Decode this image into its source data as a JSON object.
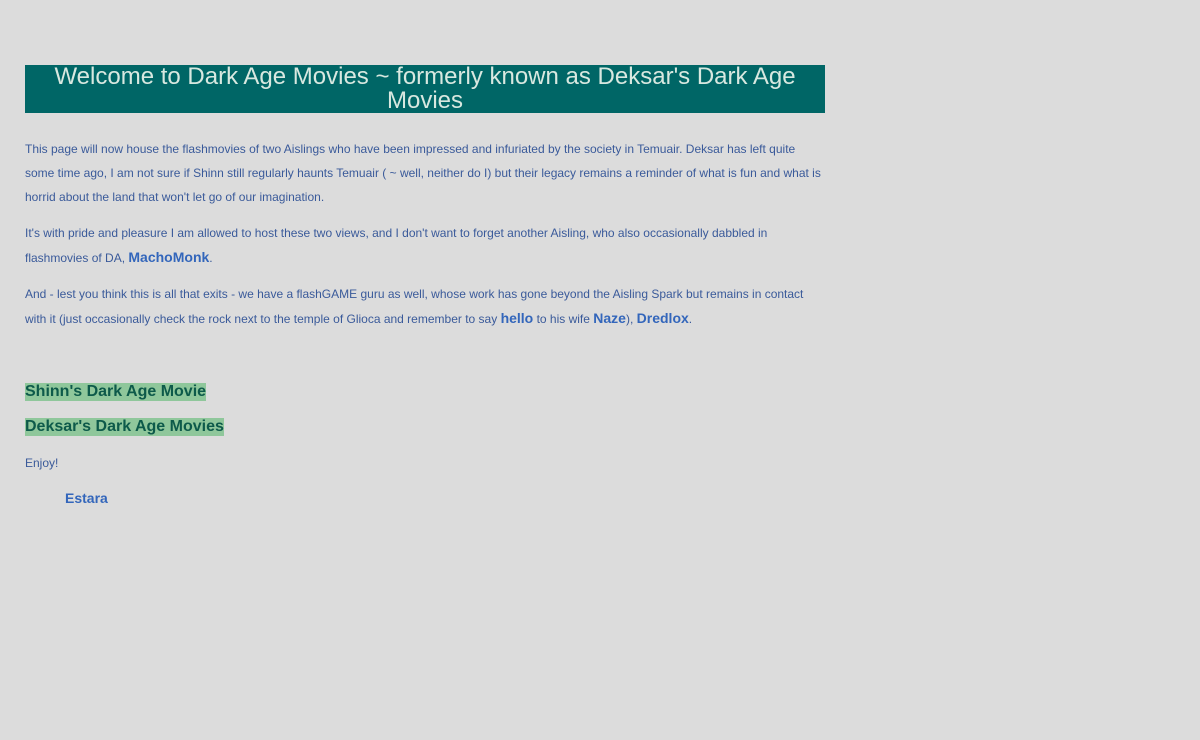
{
  "banner": {
    "title": "Welcome to Dark Age Movies ~ formerly known as Deksar's Dark Age Movies"
  },
  "intro": {
    "paragraph1": "This page will now house the flashmovies of two Aislings who have been impressed and infuriated by the society in Temuair. Deksar has left quite some time ago, I am not sure if Shinn still regularly haunts Temuair ( ~ well, neither do I) but their legacy remains a reminder of what is fun and what is horrid about the land that won't let go of our imagination.",
    "paragraph2_text": "It's with pride and pleasure I am allowed to host these two views, and I don't want to forget another Aisling, who also occasionally dabbled in flashmovies of DA,",
    "paragraph2_link": "MachoMonk",
    "paragraph2_end": ".",
    "paragraph3_text": "And - lest you think this is all that exits - we have a flashGAME guru as well, whose work has gone beyond the Aisling Spark but remains in contact with it (just occasionally check the rock next to the temple of Glioca and remember to say",
    "paragraph3_link1": "hello",
    "paragraph3_mid": "to his wife",
    "paragraph3_link2": "Naze",
    "paragraph3_sep": "),",
    "paragraph3_link3": "Dredlox",
    "paragraph3_end": "."
  },
  "movies": [
    {
      "label": "Shinn's Dark Age Movie"
    },
    {
      "label": "Deksar's Dark Age Movies"
    }
  ],
  "closing": {
    "enjoy": "Enjoy!",
    "signature": "Estara"
  },
  "colors": {
    "background": "#dcdcdc",
    "banner": "#006666",
    "body_text": "#3a5a9a",
    "link": "#3366bb",
    "movie_highlight": "#8fc79b"
  }
}
